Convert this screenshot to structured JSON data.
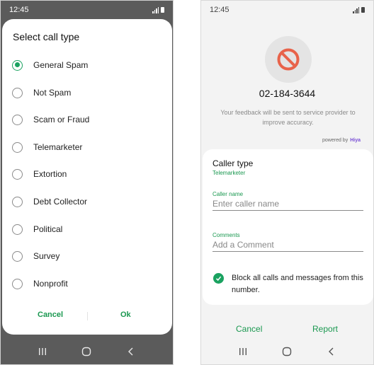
{
  "left": {
    "status_time": "12:45",
    "dialog": {
      "title": "Select call type",
      "options": [
        {
          "label": "General Spam",
          "selected": true
        },
        {
          "label": "Not Spam",
          "selected": false
        },
        {
          "label": "Scam or Fraud",
          "selected": false
        },
        {
          "label": "Telemarketer",
          "selected": false
        },
        {
          "label": "Extortion",
          "selected": false
        },
        {
          "label": "Debt Collector",
          "selected": false
        },
        {
          "label": "Political",
          "selected": false
        },
        {
          "label": "Survey",
          "selected": false
        },
        {
          "label": "Nonprofit",
          "selected": false
        }
      ],
      "cancel_label": "Cancel",
      "ok_label": "Ok"
    },
    "nav_icons": [
      "recent-apps-icon",
      "home-icon",
      "back-icon"
    ]
  },
  "right": {
    "status_time": "12:45",
    "phone_number": "02-184-3644",
    "feedback_text": "Your feedback will be sent to service provider to improve accuracy.",
    "powered_by_label": "powered by",
    "powered_by_brand": "Hiya",
    "caller_type_title": "Caller type",
    "caller_type_value": "Telemarketer",
    "caller_name": {
      "label": "Caller name",
      "placeholder": "Enter caller name",
      "value": ""
    },
    "comments": {
      "label": "Comments",
      "placeholder": "Add a Comment",
      "value": ""
    },
    "block_label": "Block all calls and messages from this number.",
    "block_checked": true,
    "cancel_label": "Cancel",
    "report_label": "Report",
    "nav_icons": [
      "recent-apps-icon",
      "home-icon",
      "back-icon"
    ]
  },
  "colors": {
    "accent_green": "#1aa260",
    "block_icon_red": "#e8634a",
    "dim_background": "#5b5b5b"
  }
}
